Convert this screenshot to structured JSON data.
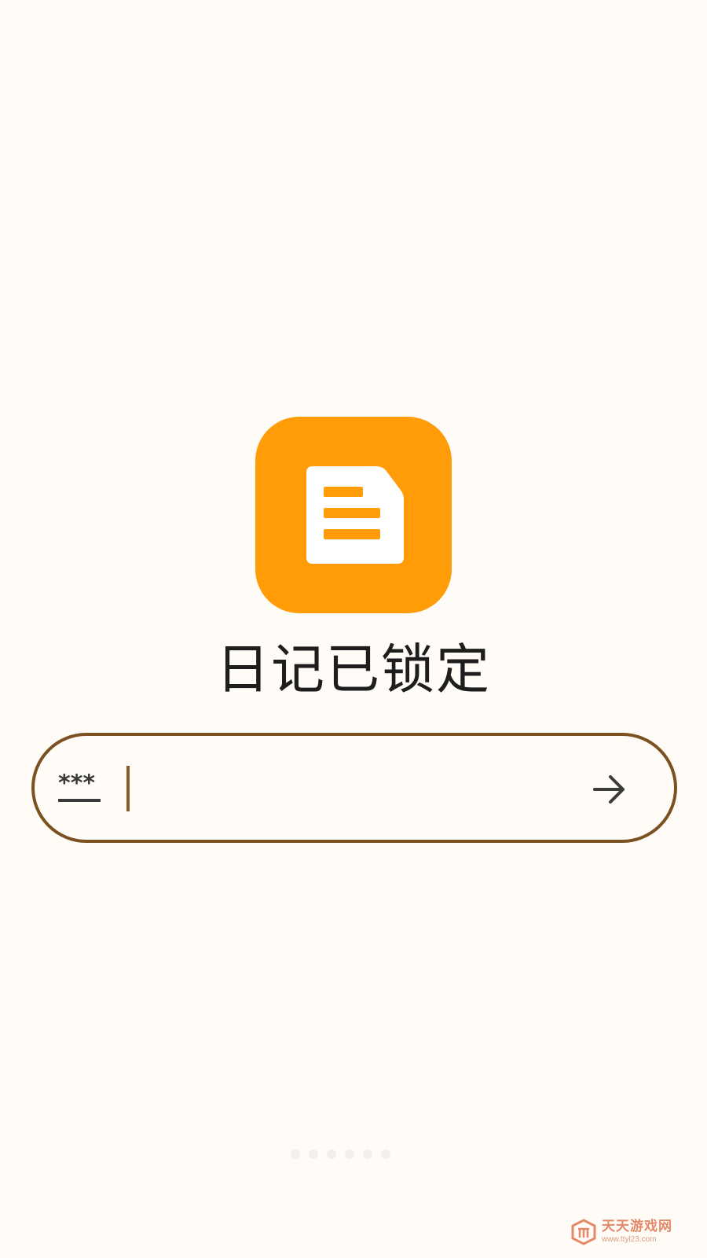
{
  "app": {
    "lock_title": "日记已锁定",
    "icon_name": "diary-document-icon"
  },
  "password_bar": {
    "placeholder": "",
    "value": "",
    "key_icon_name": "password-dots-icon",
    "key_icon_text": "***",
    "submit_icon_name": "arrow-right-icon"
  },
  "pager": {
    "dot_count": 6
  },
  "watermark": {
    "text_cn": "天天游戏网",
    "url": "www.ttyl23.com"
  },
  "colors": {
    "accent": "#FF9C07",
    "border": "#7B5121",
    "caret": "#8A5A23",
    "title": "#1E1E1E",
    "icon_dark": "#3A3A3A",
    "background": "#FFFCF8"
  }
}
